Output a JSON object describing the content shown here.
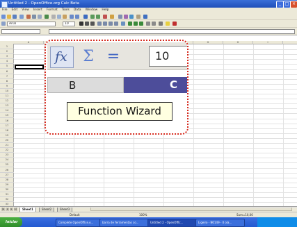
{
  "window": {
    "title": "Untitled 2 - OpenOffice.org Calc Beta"
  },
  "menu": [
    "File",
    "Edit",
    "View",
    "Insert",
    "Format",
    "Tools",
    "Data",
    "Window",
    "Help"
  ],
  "formatting": {
    "font_name": "Arial",
    "font_size": "10"
  },
  "zoom": {
    "value": "10",
    "col_b": "B",
    "col_c": "C",
    "tooltip": "Function Wizard"
  },
  "sheet_tabs": [
    "Sheet1",
    "Sheet2",
    "Sheet3"
  ],
  "status": {
    "page_style": "Default",
    "zoom": "100%",
    "sum": "Sum=10,00"
  },
  "taskbar": {
    "start": "Iniciar",
    "tasks": [
      "Complete OpenOffice.o...",
      "barra de ferramentas co...",
      "Untitled 2 - OpenOffic...",
      "Ligeiro - N0149 - 0 ola..."
    ]
  },
  "colors": {
    "callout_border": "#d62a1e",
    "selected_column": "#4d4d9a",
    "tooltip_bg": "#ffffe1",
    "titlebar": "#245ad0"
  }
}
